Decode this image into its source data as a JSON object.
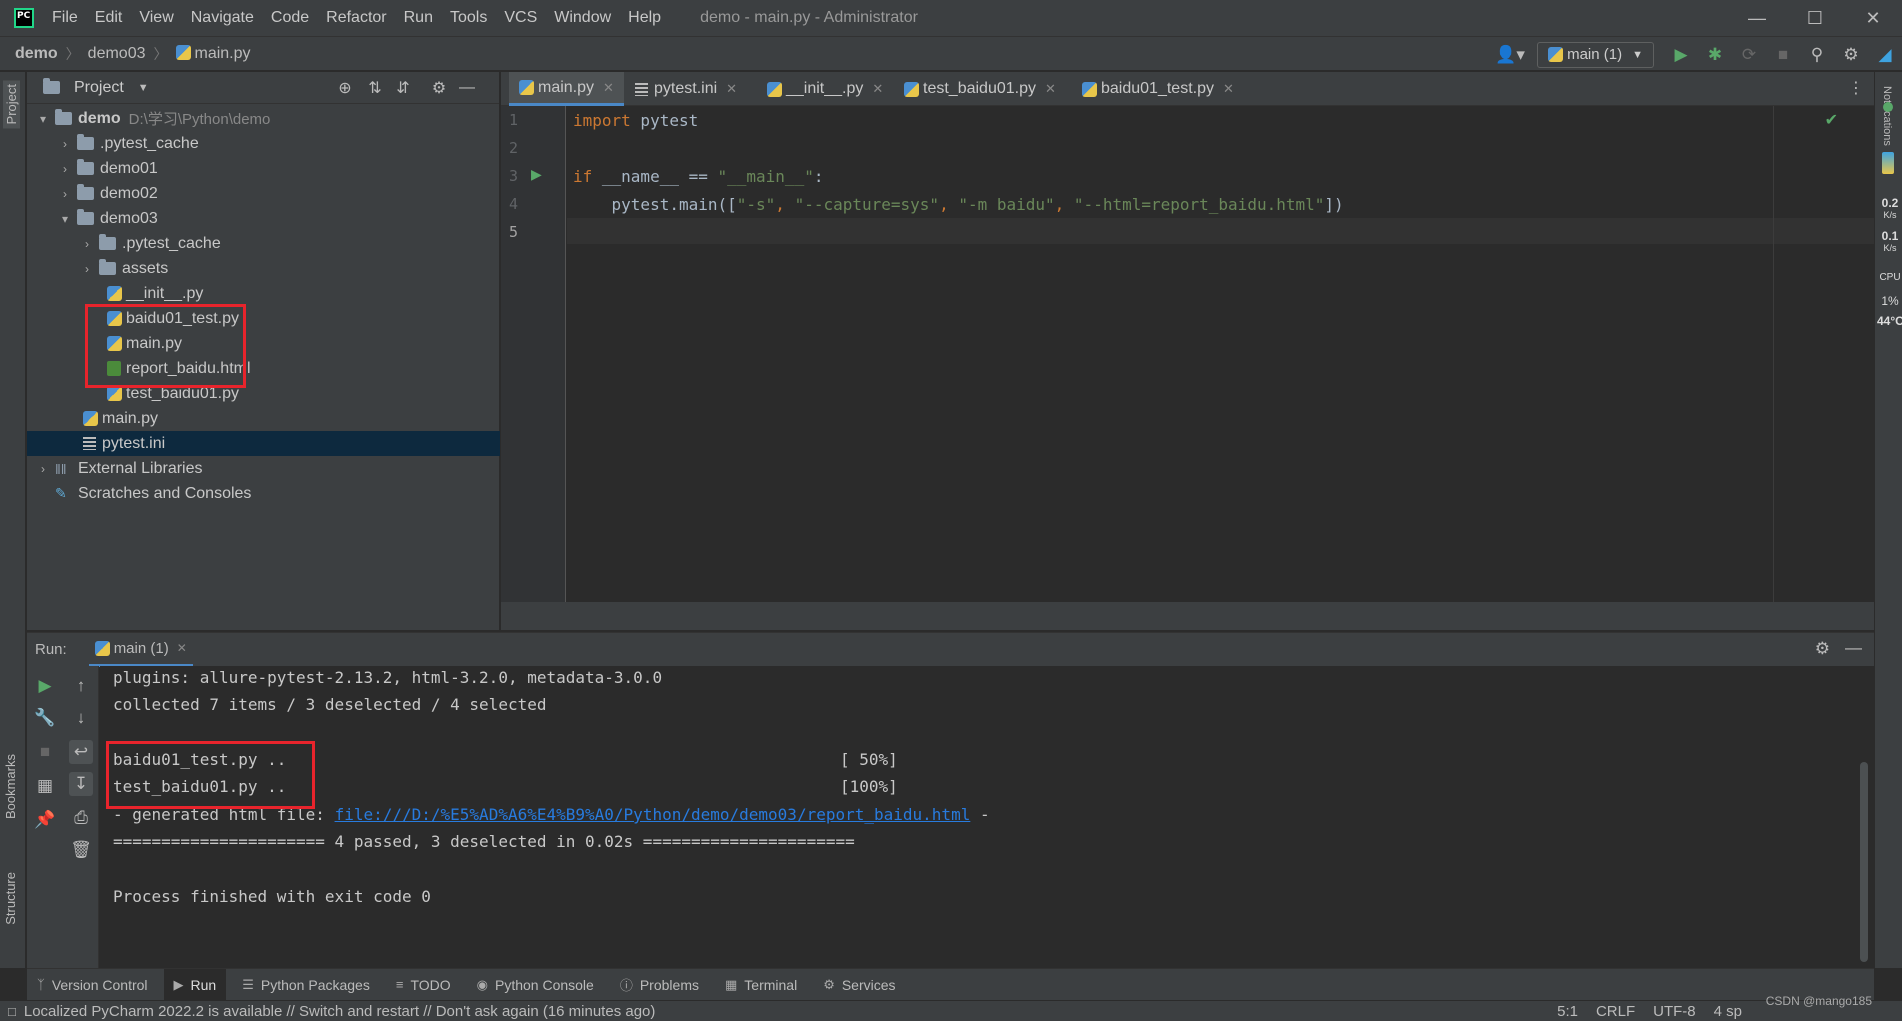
{
  "titlebar": {
    "menu": [
      "File",
      "Edit",
      "View",
      "Navigate",
      "Code",
      "Refactor",
      "Run",
      "Tools",
      "VCS",
      "Window",
      "Help"
    ],
    "window_title": "demo - main.py - Administrator"
  },
  "navbar": {
    "breadcrumb": [
      "demo",
      "demo03",
      "main.py"
    ],
    "run_config": "main (1)"
  },
  "project": {
    "title": "Project",
    "tree": [
      {
        "label": "demo",
        "note": "D:\\学习\\Python\\demo",
        "type": "folder",
        "arrow": "▾"
      },
      {
        "label": ".pytest_cache",
        "type": "folder",
        "arrow": "›"
      },
      {
        "label": "demo01",
        "type": "folder",
        "arrow": "›"
      },
      {
        "label": "demo02",
        "type": "folder",
        "arrow": "›"
      },
      {
        "label": "demo03",
        "type": "folder",
        "arrow": "▾"
      },
      {
        "label": ".pytest_cache",
        "type": "folder",
        "arrow": "›"
      },
      {
        "label": "assets",
        "type": "folder",
        "arrow": "›"
      },
      {
        "label": "__init__.py",
        "type": "py"
      },
      {
        "label": "baidu01_test.py",
        "type": "py"
      },
      {
        "label": "main.py",
        "type": "py"
      },
      {
        "label": "report_baidu.html",
        "type": "html"
      },
      {
        "label": "test_baidu01.py",
        "type": "py"
      },
      {
        "label": "main.py",
        "type": "py"
      },
      {
        "label": "pytest.ini",
        "type": "ini"
      },
      {
        "label": "External Libraries",
        "type": "lib",
        "arrow": "›"
      },
      {
        "label": "Scratches and Consoles",
        "type": "scratch"
      }
    ]
  },
  "editor": {
    "tabs": [
      "main.py",
      "pytest.ini",
      "__init__.py",
      "test_baidu01.py",
      "baidu01_test.py"
    ],
    "line_numbers": [
      "1",
      "2",
      "3",
      "4",
      "5"
    ],
    "code": {
      "l1_kw": "import",
      "l1_rest": " pytest",
      "l3_kw": "if",
      "l3_mid": " __name__ == ",
      "l3_str": "\"__main__\"",
      "l3_end": ":",
      "l4_pre": "    pytest.main([",
      "l4_s1": "\"-s\"",
      "l4_s2": "\"--capture=sys\"",
      "l4_s3": "\"-m baidu\"",
      "l4_s4": "\"--html=report_baidu.html\"",
      "l4_end": "])",
      "comma": ", "
    }
  },
  "run": {
    "label": "Run:",
    "tab": "main (1)",
    "console": {
      "line1": "plugins: allure-pytest-2.13.2, html-3.2.0, metadata-3.0.0",
      "line2": "collected 7 items / 3 deselected / 4 selected",
      "line3_file": "baidu01_test.py ..",
      "line3_pct": "[ 50%]",
      "line4_file": "test_baidu01.py ..",
      "line4_pct": "[100%]",
      "line5_pre": "- generated html file: ",
      "line5_link": "file:///D:/%E5%AD%A6%E4%B9%A0/Python/demo/demo03/report_baidu.html",
      "line5_post": " -",
      "line6": "====================== 4 passed, 3 deselected in 0.02s ======================",
      "line7": "Process finished with exit code 0"
    }
  },
  "bottom_tabs": [
    "Version Control",
    "Run",
    "Python Packages",
    "TODO",
    "Python Console",
    "Problems",
    "Terminal",
    "Services"
  ],
  "left_strip": {
    "project": "Project",
    "bookmarks": "Bookmarks",
    "structure": "Structure"
  },
  "right_strip": {
    "notifications": "Notifications",
    "m1": "0.2",
    "m1u": "K/s",
    "m2": "0.1",
    "m2u": "K/s",
    "cpu": "CPU",
    "cpu_pct": "1%",
    "temp": "44°C"
  },
  "statusbar": {
    "message": "Localized PyCharm 2022.2 is available // Switch and restart // Don't ask again (16 minutes ago)",
    "position": "5:1",
    "line_sep": "CRLF",
    "encoding": "UTF-8",
    "indent": "4 sp",
    "watermark": "CSDN @mango185"
  },
  "colors": {
    "keyword": "#cc7832",
    "string": "#6a8759",
    "link": "#287bde",
    "highlight_box": "#e8242c",
    "selection": "#0d293e"
  }
}
